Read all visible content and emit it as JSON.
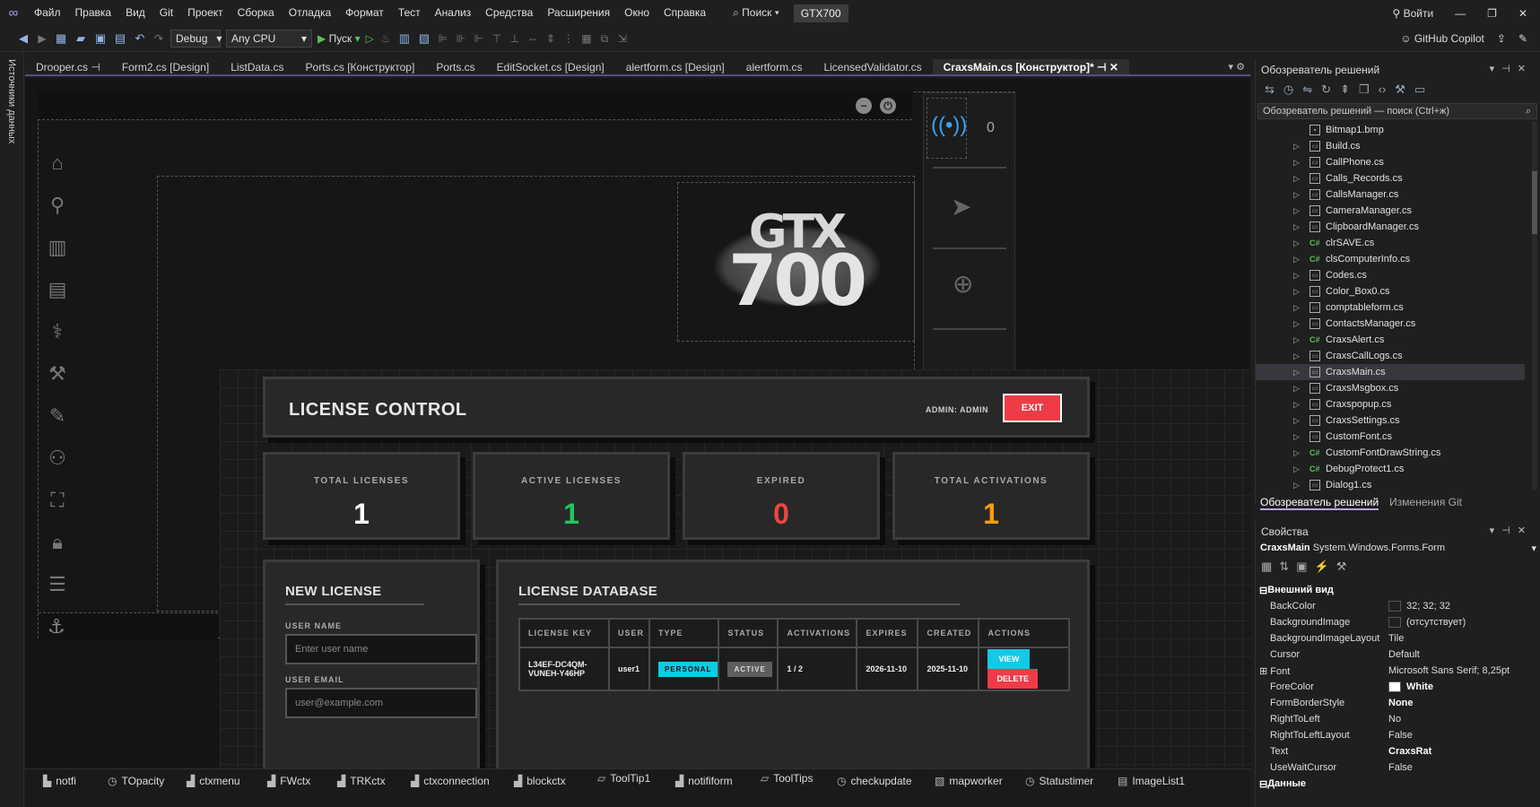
{
  "menubar": {
    "items": [
      "Файл",
      "Правка",
      "Вид",
      "Git",
      "Проект",
      "Сборка",
      "Отладка",
      "Формат",
      "Тест",
      "Анализ",
      "Средства",
      "Расширения",
      "Окно",
      "Справка"
    ],
    "search": "Поиск",
    "solution": "GTX700",
    "signin": "Войти"
  },
  "toolbar": {
    "config": "Debug",
    "platform": "Any CPU",
    "run": "Пуск",
    "copilot": "GitHub Copilot"
  },
  "leftstrip": {
    "label": "Источники данных"
  },
  "tabs": [
    "Drooper.cs",
    "Form2.cs [Design]",
    "ListData.cs",
    "Ports.cs [Конструктор]",
    "Ports.cs",
    "EditSocket.cs [Design]",
    "alertform.cs [Design]",
    "alertform.cs",
    "LicensedValidator.cs",
    "CraxsMain.cs [Конструктор]*"
  ],
  "designer": {
    "logo_top": "GTX",
    "logo_bottom": "700",
    "counter": "0"
  },
  "license": {
    "title": "LICENSE CONTROL",
    "admin": "ADMIN: ADMIN",
    "exit": "EXIT",
    "stats": [
      {
        "label": "TOTAL LICENSES",
        "value": "1",
        "color": "#ffffff"
      },
      {
        "label": "ACTIVE LICENSES",
        "value": "1",
        "color": "#22c55e"
      },
      {
        "label": "EXPIRED",
        "value": "0",
        "color": "#ef4444"
      },
      {
        "label": "TOTAL ACTIVATIONS",
        "value": "1",
        "color": "#f59e0b"
      }
    ],
    "new": {
      "title": "NEW LICENSE",
      "name_label": "USER NAME",
      "name_placeholder": "Enter user name",
      "email_label": "USER EMAIL",
      "email_placeholder": "user@example.com"
    },
    "db": {
      "title": "LICENSE DATABASE",
      "headers": [
        "LICENSE KEY",
        "USER",
        "TYPE",
        "STATUS",
        "ACTIVATIONS",
        "EXPIRES",
        "CREATED",
        "ACTIONS"
      ],
      "row": {
        "key": "L34EF-DC4QM-VUNEH-Y46HP",
        "user": "user1",
        "type": "PERSONAL",
        "status": "ACTIVE",
        "activations": "1 / 2",
        "expires": "2026-11-10",
        "created": "2025-11-10",
        "view": "VIEW",
        "delete": "DELETE"
      }
    }
  },
  "tray": [
    "notfi",
    "TOpacity",
    "ctxmenu",
    "FWctx",
    "TRKctx",
    "ctxconnection",
    "blockctx",
    "ToolTip1",
    "notifiform",
    "ToolTips",
    "checkupdate",
    "mapworker",
    "Statustimer",
    "ImageList1"
  ],
  "solution_explorer": {
    "title": "Обозреватель решений",
    "search": "Обозреватель решений — поиск (Ctrl+ж)",
    "files": [
      {
        "name": "Bitmap1.bmp",
        "kind": "file"
      },
      {
        "name": "Build.cs",
        "kind": "file"
      },
      {
        "name": "CallPhone.cs",
        "kind": "file"
      },
      {
        "name": "Calls_Records.cs",
        "kind": "file"
      },
      {
        "name": "CallsManager.cs",
        "kind": "file"
      },
      {
        "name": "CameraManager.cs",
        "kind": "file"
      },
      {
        "name": "ClipboardManager.cs",
        "kind": "file"
      },
      {
        "name": "clrSAVE.cs",
        "kind": "cs"
      },
      {
        "name": "clsComputerInfo.cs",
        "kind": "cs"
      },
      {
        "name": "Codes.cs",
        "kind": "file"
      },
      {
        "name": "Color_Box0.cs",
        "kind": "file"
      },
      {
        "name": "comptableform.cs",
        "kind": "file"
      },
      {
        "name": "ContactsManager.cs",
        "kind": "file"
      },
      {
        "name": "CraxsAlert.cs",
        "kind": "cs"
      },
      {
        "name": "CraxsCallLogs.cs",
        "kind": "file"
      },
      {
        "name": "CraxsMain.cs",
        "kind": "file",
        "selected": true
      },
      {
        "name": "CraxsMsgbox.cs",
        "kind": "file"
      },
      {
        "name": "Craxspopup.cs",
        "kind": "file"
      },
      {
        "name": "CraxsSettings.cs",
        "kind": "file"
      },
      {
        "name": "CustomFont.cs",
        "kind": "file"
      },
      {
        "name": "CustomFontDrawString.cs",
        "kind": "cs"
      },
      {
        "name": "DebugProtect1.cs",
        "kind": "cs"
      },
      {
        "name": "Dialog1.cs",
        "kind": "file"
      }
    ],
    "tab_active": "Обозреватель решений",
    "tab_other": "Изменения Git"
  },
  "properties": {
    "title": "Свойства",
    "object": "CraxsMain",
    "type": "System.Windows.Forms.Form",
    "category": "Внешний вид",
    "category2": "Данные",
    "rows": [
      {
        "k": "BackColor",
        "v": "32; 32; 32",
        "swatch": "#202020"
      },
      {
        "k": "BackgroundImage",
        "v": "(отсутствует)",
        "swatch": "#202020"
      },
      {
        "k": "BackgroundImageLayout",
        "v": "Tile"
      },
      {
        "k": "Cursor",
        "v": "Default"
      },
      {
        "k": "Font",
        "v": "Microsoft Sans Serif; 8,25pt",
        "expand": true
      },
      {
        "k": "ForeColor",
        "v": "White",
        "swatch": "#ffffff",
        "bold": true
      },
      {
        "k": "FormBorderStyle",
        "v": "None",
        "bold": true
      },
      {
        "k": "RightToLeft",
        "v": "No"
      },
      {
        "k": "RightToLeftLayout",
        "v": "False"
      },
      {
        "k": "Text",
        "v": "CraxsRat",
        "bold": true
      },
      {
        "k": "UseWaitCursor",
        "v": "False"
      }
    ]
  }
}
